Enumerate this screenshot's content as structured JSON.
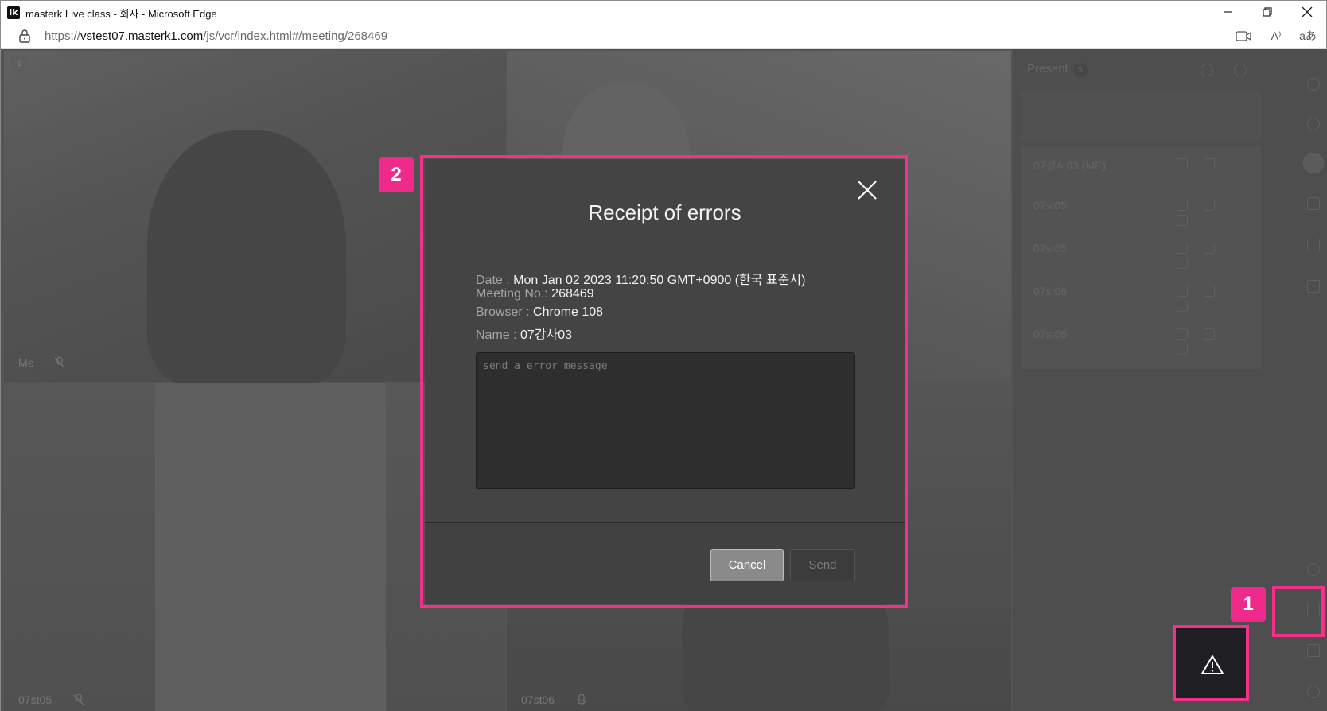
{
  "window": {
    "title": "masterk Live class - 회사 - Microsoft Edge",
    "logo_letter": "lk"
  },
  "address": {
    "prefix": "https://",
    "host": "vstest07.masterk1.com",
    "path": "/js/vcr/index.html#/meeting/268469",
    "read_aloud_icon": "A⁾",
    "translate_icon": "aあ"
  },
  "meeting": {
    "tiles": [
      {
        "number": "1",
        "label": "Me"
      },
      {
        "label": ""
      },
      {
        "label": "07st05"
      },
      {
        "label": "07st06"
      }
    ],
    "panel": {
      "title": "Present",
      "count": "5",
      "participants": [
        "07강사03 (ME)",
        "07st05",
        "07st05",
        "07st06",
        "07st06"
      ]
    }
  },
  "dialog": {
    "title": "Receipt of errors",
    "date_label": "Date :",
    "date_value": "Mon Jan 02 2023 11:20:50 GMT+0900 (한국 표준시)",
    "meeting_label": "Meeting No.:",
    "meeting_value": "268469",
    "browser_label": "Browser :",
    "browser_value": "Chrome 108",
    "name_label": "Name :",
    "name_value": "07강사03",
    "message_placeholder": "send a error message",
    "cancel_label": "Cancel",
    "send_label": "Send"
  },
  "annotations": {
    "badge_1": "1",
    "badge_2": "2",
    "highlight_color": "#f4318a"
  }
}
